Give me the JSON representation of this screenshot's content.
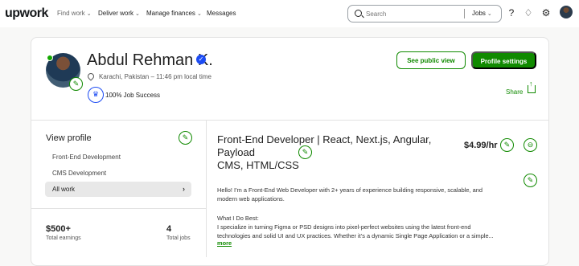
{
  "topbar": {
    "logo": "upwork",
    "nav": [
      {
        "label": "Find work",
        "muted": true
      },
      {
        "label": "Deliver work",
        "muted": false
      },
      {
        "label": "Manage finances",
        "muted": false
      },
      {
        "label": "Messages",
        "muted": false
      }
    ],
    "search_placeholder": "Search",
    "search_scope": "Jobs",
    "icons": [
      "help-icon",
      "notifications-icon",
      "settings-icon",
      "user-avatar-icon"
    ]
  },
  "profile": {
    "name": "Abdul Rehman K.",
    "location": "Karachi, Pakistan – 11:46 pm local time",
    "job_success": "100% Job Success",
    "public_view_label": "See public view",
    "settings_label": "Profile settings",
    "share_label": "Share"
  },
  "sidebar": {
    "title": "View profile",
    "items": [
      "Front-End Development",
      "CMS Development",
      "All work"
    ],
    "earnings_value": "$500+",
    "earnings_label": "Total earnings",
    "jobs_value": "4",
    "jobs_label": "Total jobs"
  },
  "main": {
    "headline_line1": "Front-End Developer | React, Next.js, Angular, Payload",
    "headline_line2": "CMS, HTML/CSS",
    "rate": "$4.99/hr",
    "intro_line1": "Hello! I’m a Front-End Web Developer with 2+ years of experience building responsive, scalable, and",
    "intro_line2": "modern web applications.",
    "section_title": "What I Do Best:",
    "section_line1": "I specialize in turning Figma or PSD designs into pixel-perfect websites using the latest front-end",
    "section_line2": "technologies and solid UI and UX practices. Whether it’s a dynamic Single Page Application or a simple...",
    "more_label": "more"
  }
}
